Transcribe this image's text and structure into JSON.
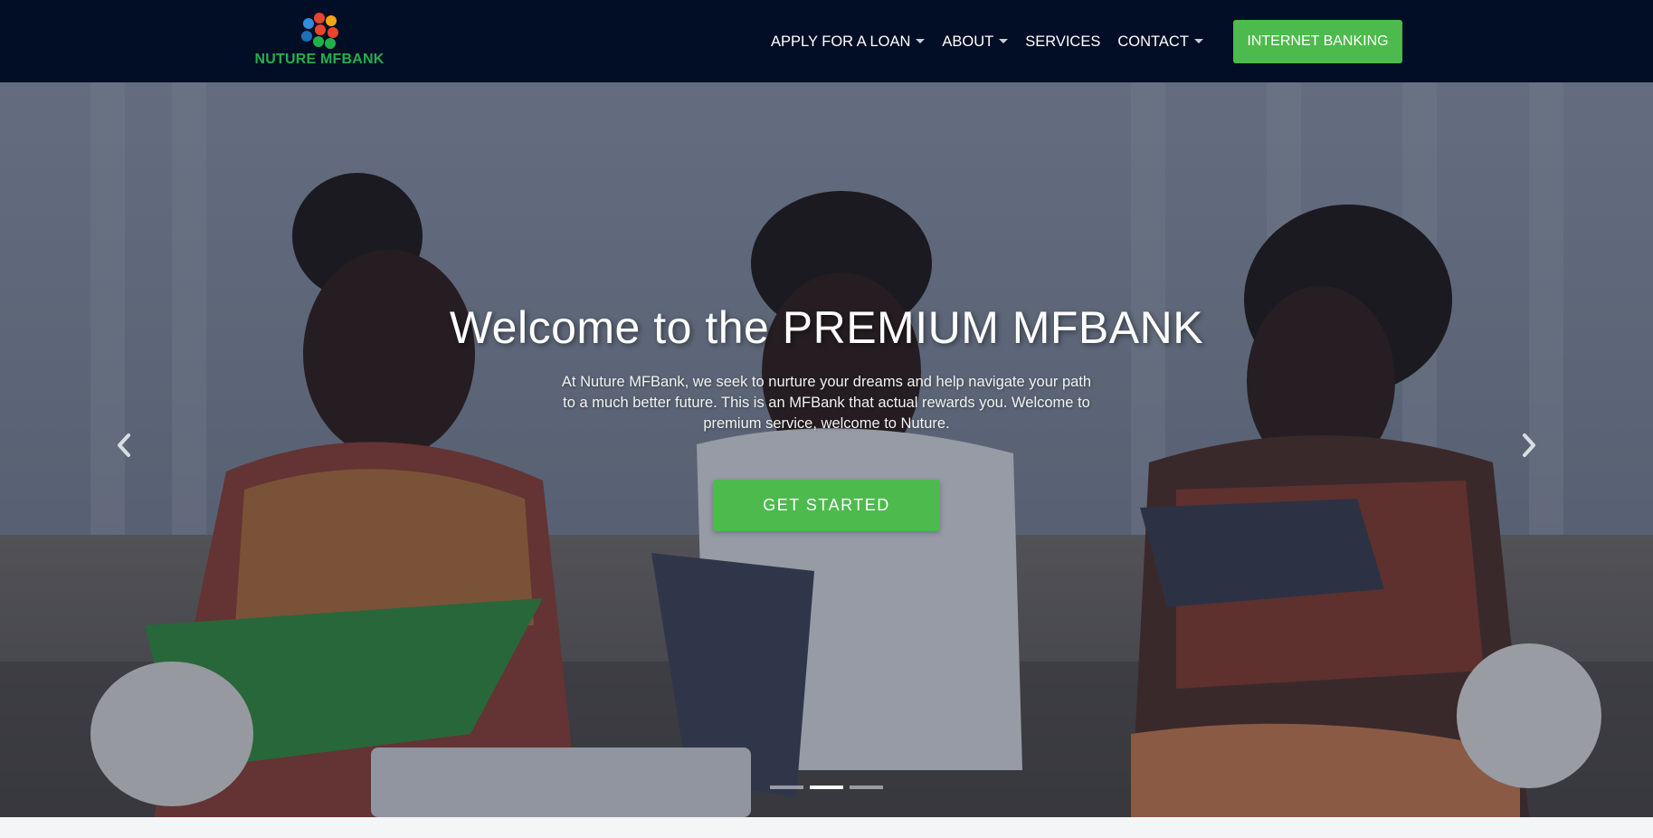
{
  "brand": {
    "name": "NUTURE MFBANK",
    "logo_icon": "dotted-circle-logo-icon",
    "logo_colors": [
      "#e8452c",
      "#f3a31b",
      "#2f8fd8",
      "#22b04b",
      "#1c6fb8"
    ]
  },
  "nav": {
    "items": [
      {
        "label": "APPLY FOR A LOAN",
        "has_dropdown": true
      },
      {
        "label": "ABOUT",
        "has_dropdown": true
      },
      {
        "label": "SERVICES",
        "has_dropdown": false
      },
      {
        "label": "CONTACT",
        "has_dropdown": true
      }
    ],
    "cta_label": "INTERNET BANKING"
  },
  "hero": {
    "title": "Welcome to the PREMIUM MFBANK",
    "text": "At Nuture MFBank, we seek to nurture your dreams and help navigate your path to a much better future. This is an MFBank that actual rewards you. Welcome to premium service, welcome to Nuture.",
    "button_label": "GET STARTED",
    "prev_icon": "chevron-left-icon",
    "next_icon": "chevron-right-icon",
    "slides": 3,
    "active_slide": 1
  },
  "colors": {
    "navbar_bg": "#020e25",
    "accent_green": "#4cba4c",
    "brand_green": "#22b04b"
  }
}
